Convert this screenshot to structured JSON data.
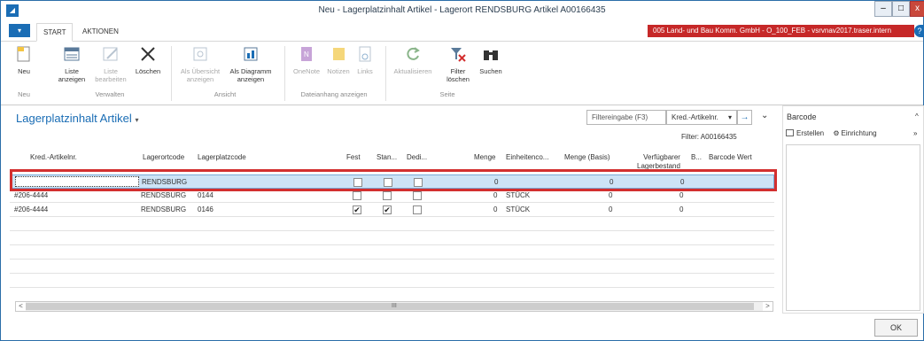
{
  "window": {
    "title": "Neu - Lagerplatzinhalt Artikel - Lagerort RENDSBURG Artikel A00166435",
    "app_icon": "nav-icon",
    "min_label": "–",
    "max_label": "□",
    "close_label": "x"
  },
  "tabs": {
    "menu_label": "▾",
    "items": [
      "START",
      "AKTIONEN"
    ],
    "company": "005 Land- und Bau Komm. GmbH - O_100_FEB - vsrvnav2017.traser.intern",
    "help": "?"
  },
  "ribbon": {
    "buttons": {
      "neu": {
        "l1": "Neu",
        "l2": ""
      },
      "liste_anzeigen": {
        "l1": "Liste",
        "l2": "anzeigen"
      },
      "liste_bearbeiten": {
        "l1": "Liste",
        "l2": "bearbeiten"
      },
      "loeschen": {
        "l1": "Löschen",
        "l2": ""
      },
      "als_uebersicht": {
        "l1": "Als Übersicht",
        "l2": "anzeigen"
      },
      "als_diagramm": {
        "l1": "Als Diagramm",
        "l2": "anzeigen"
      },
      "onenote": {
        "l1": "OneNote",
        "l2": ""
      },
      "notizen": {
        "l1": "Notizen",
        "l2": ""
      },
      "links": {
        "l1": "Links",
        "l2": ""
      },
      "aktualisieren": {
        "l1": "Aktualisieren",
        "l2": ""
      },
      "filter_loeschen": {
        "l1": "Filter",
        "l2": "löschen"
      },
      "suchen": {
        "l1": "Suchen",
        "l2": ""
      }
    },
    "groups": {
      "neu": "Neu",
      "verwalten": "Verwalten",
      "ansicht": "Ansicht",
      "dateianhang": "Dateianhang anzeigen",
      "seite": "Seite"
    }
  },
  "page": {
    "title": "Lagerplatzinhalt Artikel",
    "title_chevron": "▾"
  },
  "filter": {
    "placeholder": "Filtereingabe (F3)",
    "field": "Kred.-Artikelnr.",
    "field_chevron": "▾",
    "go": "→",
    "chevron": "⌄",
    "active_filter": "Filter: A00166435"
  },
  "table": {
    "columns": {
      "kred": "Kred.-Artikelnr.",
      "lagerortcode": "Lagerortcode",
      "lagerplatzcode": "Lagerplatzcode",
      "fest": "Fest",
      "standard": "Stan...",
      "dedi": "Dedi...",
      "menge": "Menge",
      "einheit": "Einheitenco...",
      "menge_basis": "Menge (Basis)",
      "verfuegbar_l1": "Verfügbarer",
      "verfuegbar_l2": "Lagerbestand",
      "b": "B...",
      "barcode": "Barcode Wert"
    },
    "rows": [
      {
        "kred": "",
        "lagerort": "RENDSBURG",
        "lagerplatz": "",
        "fest": false,
        "standard": false,
        "dedi": false,
        "menge": "0",
        "einheit": "",
        "menge_basis": "0",
        "verfuegbar": "0"
      },
      {
        "kred": "#206-4444",
        "lagerort": "RENDSBURG",
        "lagerplatz": "0144",
        "fest": false,
        "standard": false,
        "dedi": false,
        "menge": "0",
        "einheit": "STÜCK",
        "menge_basis": "0",
        "verfuegbar": "0"
      },
      {
        "kred": "#206-4444",
        "lagerort": "RENDSBURG",
        "lagerplatz": "0146",
        "fest": true,
        "standard": true,
        "dedi": false,
        "menge": "0",
        "einheit": "STÜCK",
        "menge_basis": "0",
        "verfuegbar": "0"
      }
    ]
  },
  "scrollbar": {
    "left": "<",
    "right": ">",
    "grip": "III"
  },
  "factbox": {
    "title": "Barcode",
    "collapse": "^",
    "erstellen": "Erstellen",
    "einrichtung": "Einrichtung",
    "more": "»"
  },
  "ok_label": "OK",
  "colors": {
    "accent": "#1a6db5",
    "company_bg": "#c62828",
    "selection": "#cde3f6",
    "highlight": "#d32f2f"
  }
}
